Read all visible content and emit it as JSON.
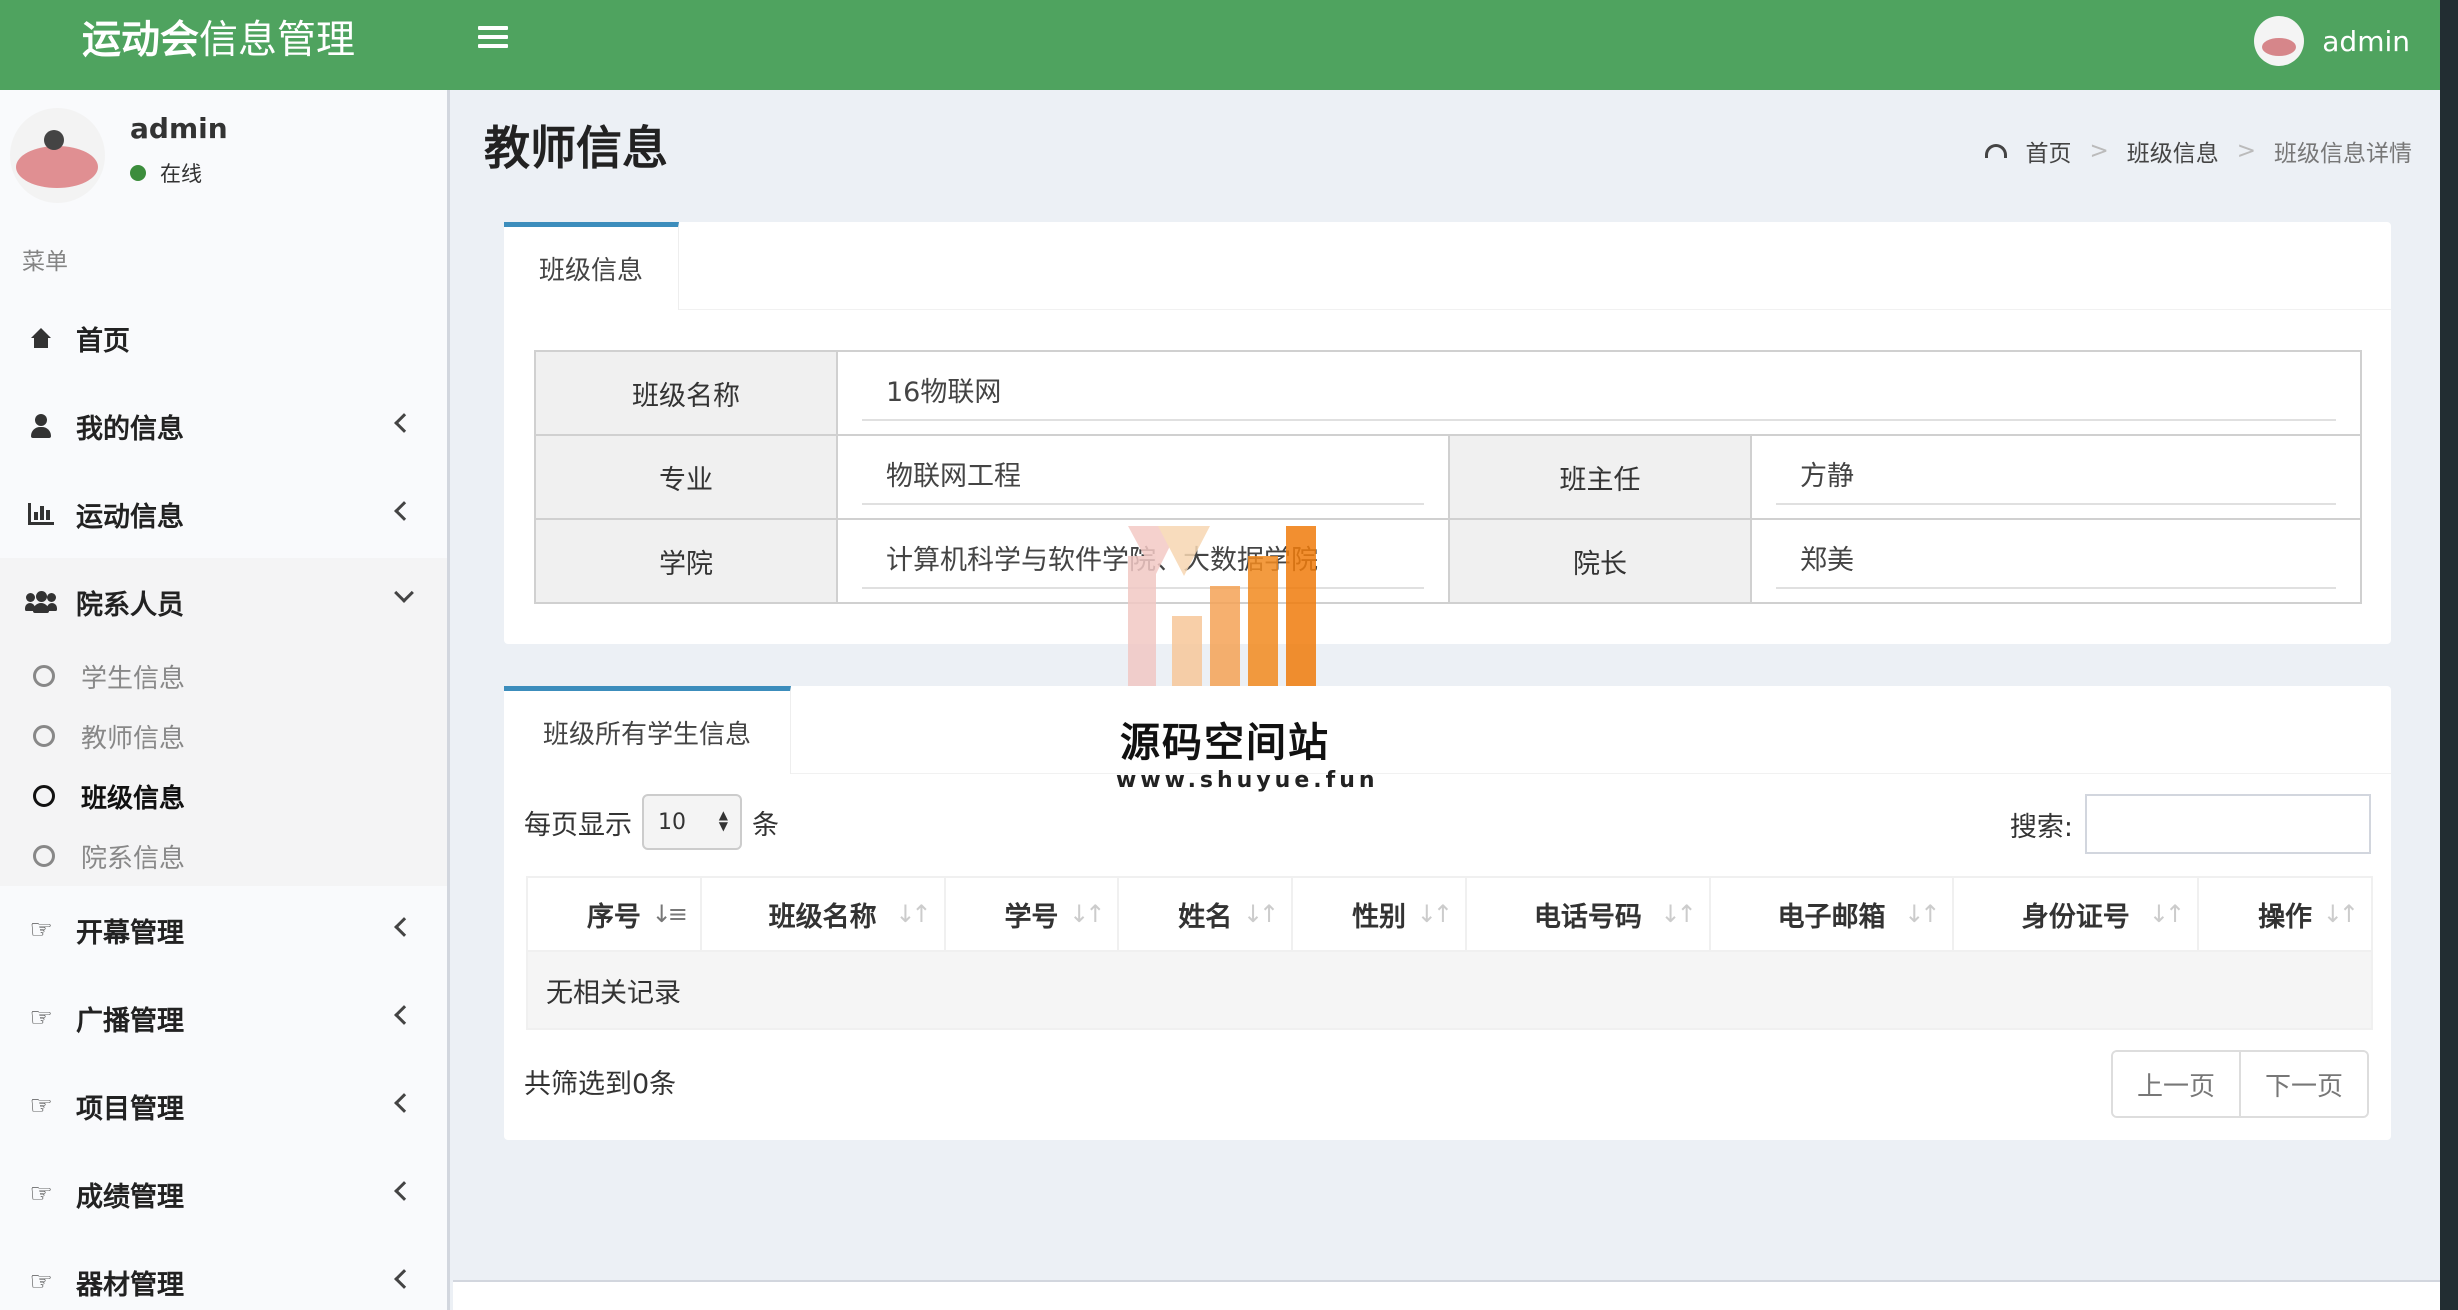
{
  "header": {
    "logo_bold": "运动会",
    "logo_light": "信息管理",
    "user_name": "admin"
  },
  "sidebar": {
    "user": {
      "name": "admin",
      "status": "在线"
    },
    "menu_header": "菜单",
    "items": [
      {
        "label": "首页",
        "icon": "home-icon"
      },
      {
        "label": "我的信息",
        "icon": "user-icon"
      },
      {
        "label": "运动信息",
        "icon": "bar-chart-icon"
      },
      {
        "label": "院系人员",
        "icon": "users-icon"
      },
      {
        "label": "开幕管理",
        "icon": "thumbs-up-icon"
      },
      {
        "label": "广播管理",
        "icon": "thumbs-up-icon"
      },
      {
        "label": "项目管理",
        "icon": "thumbs-up-icon"
      },
      {
        "label": "成绩管理",
        "icon": "thumbs-up-icon"
      },
      {
        "label": "器材管理",
        "icon": "thumbs-up-icon"
      }
    ],
    "submenu": [
      {
        "label": "学生信息"
      },
      {
        "label": "教师信息"
      },
      {
        "label": "班级信息"
      },
      {
        "label": "院系信息"
      }
    ]
  },
  "page": {
    "title": "教师信息",
    "breadcrumb": [
      "首页",
      "班级信息",
      "班级信息详情"
    ]
  },
  "class_box": {
    "tab": "班级信息",
    "fields": {
      "class_name_label": "班级名称",
      "class_name": "16物联网",
      "major_label": "专业",
      "major": "物联网工程",
      "head_teacher_label": "班主任",
      "head_teacher": "方静",
      "college_label": "学院",
      "college": "计算机科学与软件学院、大数据学院",
      "dean_label": "院长",
      "dean": "郑美"
    }
  },
  "students_box": {
    "tab": "班级所有学生信息",
    "length_prefix": "每页显示",
    "length_value": "10",
    "length_suffix": "条",
    "search_label": "搜索:",
    "columns": [
      "序号",
      "班级名称",
      "学号",
      "姓名",
      "性别",
      "电话号码",
      "电子邮箱",
      "身份证号",
      "操作"
    ],
    "empty_text": "无相关记录",
    "info": "共筛选到0条",
    "prev": "上一页",
    "next": "下一页"
  },
  "watermark": {
    "title": "源码空间站",
    "url": "www.shuyue.fun"
  },
  "colors": {
    "header_bg": "#4fa35f",
    "tab_accent": "#3c8dbc",
    "content_bg": "#ecf0f5"
  }
}
